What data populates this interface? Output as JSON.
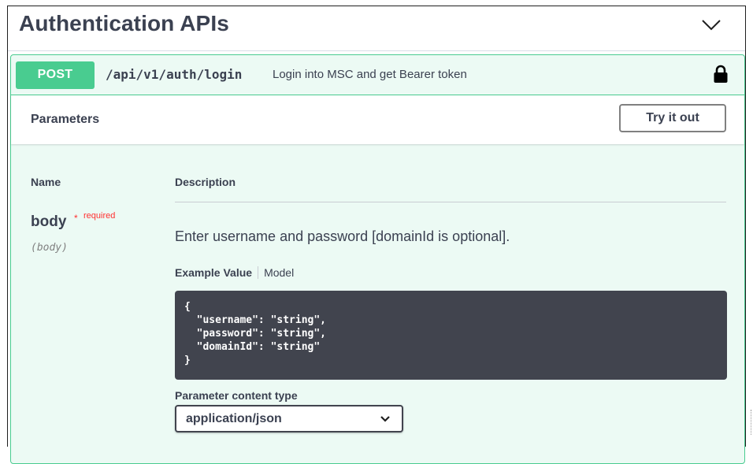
{
  "section": {
    "title": "Authentication APIs",
    "toggle_icon": "chevron-down-icon"
  },
  "operation": {
    "method": "POST",
    "path": "/api/v1/auth/login",
    "summary": "Login into MSC and get Bearer token",
    "lock_icon": "lock-icon",
    "method_color": "#49cc90"
  },
  "parameters": {
    "title": "Parameters",
    "try_it_out_label": "Try it out",
    "columns": {
      "name": "Name",
      "description": "Description"
    },
    "items": [
      {
        "name": "body",
        "required_star": "*",
        "required_label": "required",
        "location": "(body)",
        "description": "Enter username and password [domainId is optional].",
        "example_tab": "Example Value",
        "model_tab": "Model",
        "example_code": "{\n  \"username\": \"string\",\n  \"password\": \"string\",\n  \"domainId\": \"string\"\n}",
        "content_type_label": "Parameter content type",
        "content_type_value": "application/json"
      }
    ]
  },
  "colors": {
    "code_bg": "#41444e",
    "required": "#ff3030",
    "text": "#3b4151"
  }
}
